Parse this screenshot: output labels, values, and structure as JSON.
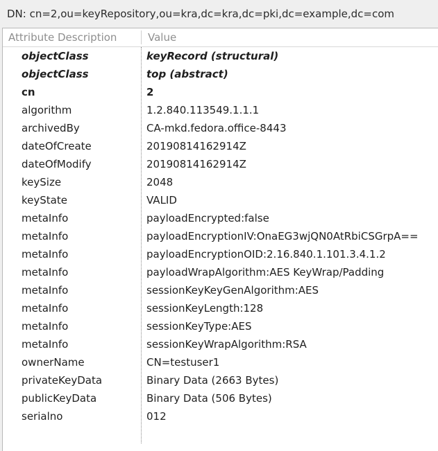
{
  "dn": {
    "label": "DN: cn=2,ou=keyRepository,ou=kra,dc=kra,dc=pki,dc=example,dc=com"
  },
  "table": {
    "headers": {
      "attribute": "Attribute Description",
      "value": "Value"
    },
    "rows": [
      {
        "attribute": "objectClass",
        "value": "keyRecord (structural)",
        "kind": "objectclass"
      },
      {
        "attribute": "objectClass",
        "value": "top (abstract)",
        "kind": "objectclass"
      },
      {
        "attribute": "cn",
        "value": "2",
        "kind": "must"
      },
      {
        "attribute": "algorithm",
        "value": "1.2.840.113549.1.1.1",
        "kind": "may"
      },
      {
        "attribute": "archivedBy",
        "value": "CA-mkd.fedora.office-8443",
        "kind": "may"
      },
      {
        "attribute": "dateOfCreate",
        "value": "20190814162914Z",
        "kind": "may"
      },
      {
        "attribute": "dateOfModify",
        "value": "20190814162914Z",
        "kind": "may"
      },
      {
        "attribute": "keySize",
        "value": "2048",
        "kind": "may"
      },
      {
        "attribute": "keyState",
        "value": "VALID",
        "kind": "may"
      },
      {
        "attribute": "metaInfo",
        "value": "payloadEncrypted:false",
        "kind": "may"
      },
      {
        "attribute": "metaInfo",
        "value": "payloadEncryptionIV:OnaEG3wjQN0AtRbiCSGrpA==",
        "kind": "may"
      },
      {
        "attribute": "metaInfo",
        "value": "payloadEncryptionOID:2.16.840.1.101.3.4.1.2",
        "kind": "may"
      },
      {
        "attribute": "metaInfo",
        "value": "payloadWrapAlgorithm:AES KeyWrap/Padding",
        "kind": "may"
      },
      {
        "attribute": "metaInfo",
        "value": "sessionKeyKeyGenAlgorithm:AES",
        "kind": "may"
      },
      {
        "attribute": "metaInfo",
        "value": "sessionKeyLength:128",
        "kind": "may"
      },
      {
        "attribute": "metaInfo",
        "value": "sessionKeyType:AES",
        "kind": "may"
      },
      {
        "attribute": "metaInfo",
        "value": "sessionKeyWrapAlgorithm:RSA",
        "kind": "may"
      },
      {
        "attribute": "ownerName",
        "value": "CN=testuser1",
        "kind": "may"
      },
      {
        "attribute": "privateKeyData",
        "value": "Binary Data (2663 Bytes)",
        "kind": "may"
      },
      {
        "attribute": "publicKeyData",
        "value": "Binary Data (506 Bytes)",
        "kind": "may"
      },
      {
        "attribute": "serialno",
        "value": "012",
        "kind": "may"
      }
    ]
  }
}
